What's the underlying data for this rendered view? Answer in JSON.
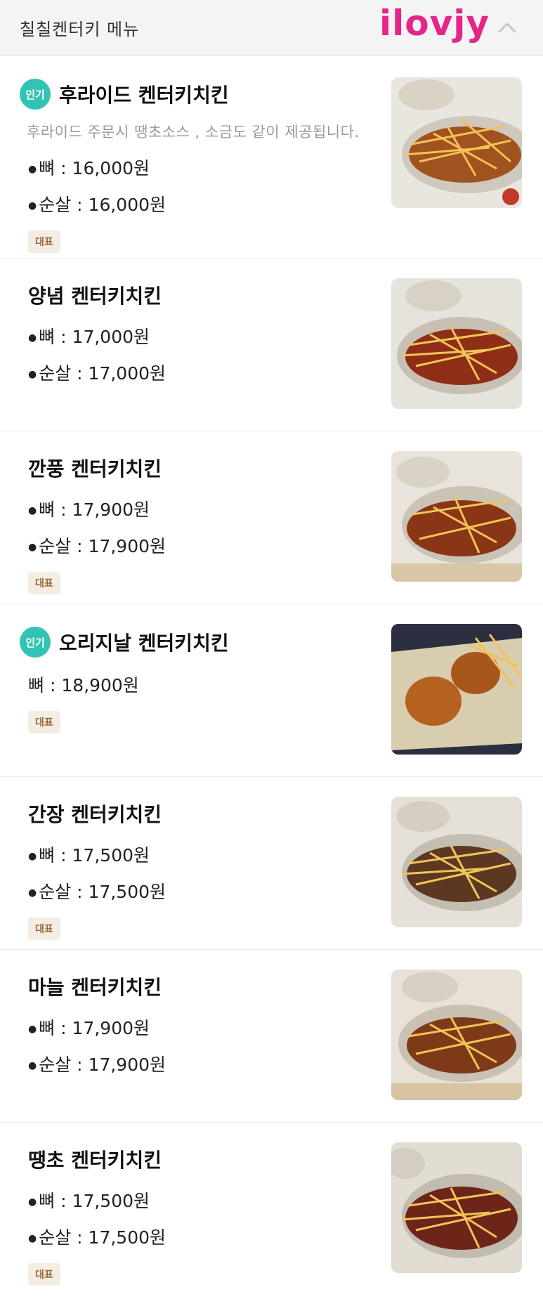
{
  "header": {
    "title": "칠칠켄터키 메뉴",
    "watermark": "ilovjy"
  },
  "popular_badge": "인기",
  "rep_tag": "대표",
  "items": [
    {
      "name": "후라이드 켄터키치킨",
      "popular": true,
      "desc": "후라이드 주문시 땡초소스 , 소금도 같이 제공됩니다.",
      "prices": [
        "뼈 : 16,000원",
        "순살 : 16,000원"
      ],
      "tag": true
    },
    {
      "name": "양념 켄터키치킨",
      "popular": false,
      "desc": "",
      "prices": [
        "뼈 : 17,000원",
        "순살 : 17,000원"
      ],
      "tag": false
    },
    {
      "name": "깐풍 켄터키치킨",
      "popular": false,
      "desc": "",
      "prices": [
        "뼈 : 17,900원",
        "순살 : 17,900원"
      ],
      "tag": true
    },
    {
      "name": "오리지날 켄터키치킨",
      "popular": true,
      "desc": "",
      "prices": [
        "뼈 : 18,900원"
      ],
      "tag": true
    },
    {
      "name": "간장 켄터키치킨",
      "popular": false,
      "desc": "",
      "prices": [
        "뼈 : 17,500원",
        "순살 : 17,500원"
      ],
      "tag": true
    },
    {
      "name": "마늘 켄터키치킨",
      "popular": false,
      "desc": "",
      "prices": [
        "뼈 : 17,900원",
        "순살 : 17,900원"
      ],
      "tag": false
    },
    {
      "name": "땡초 켄터키치킨",
      "popular": false,
      "desc": "",
      "prices": [
        "뼈 : 17,500원",
        "순살 : 17,500원"
      ],
      "tag": true
    }
  ]
}
